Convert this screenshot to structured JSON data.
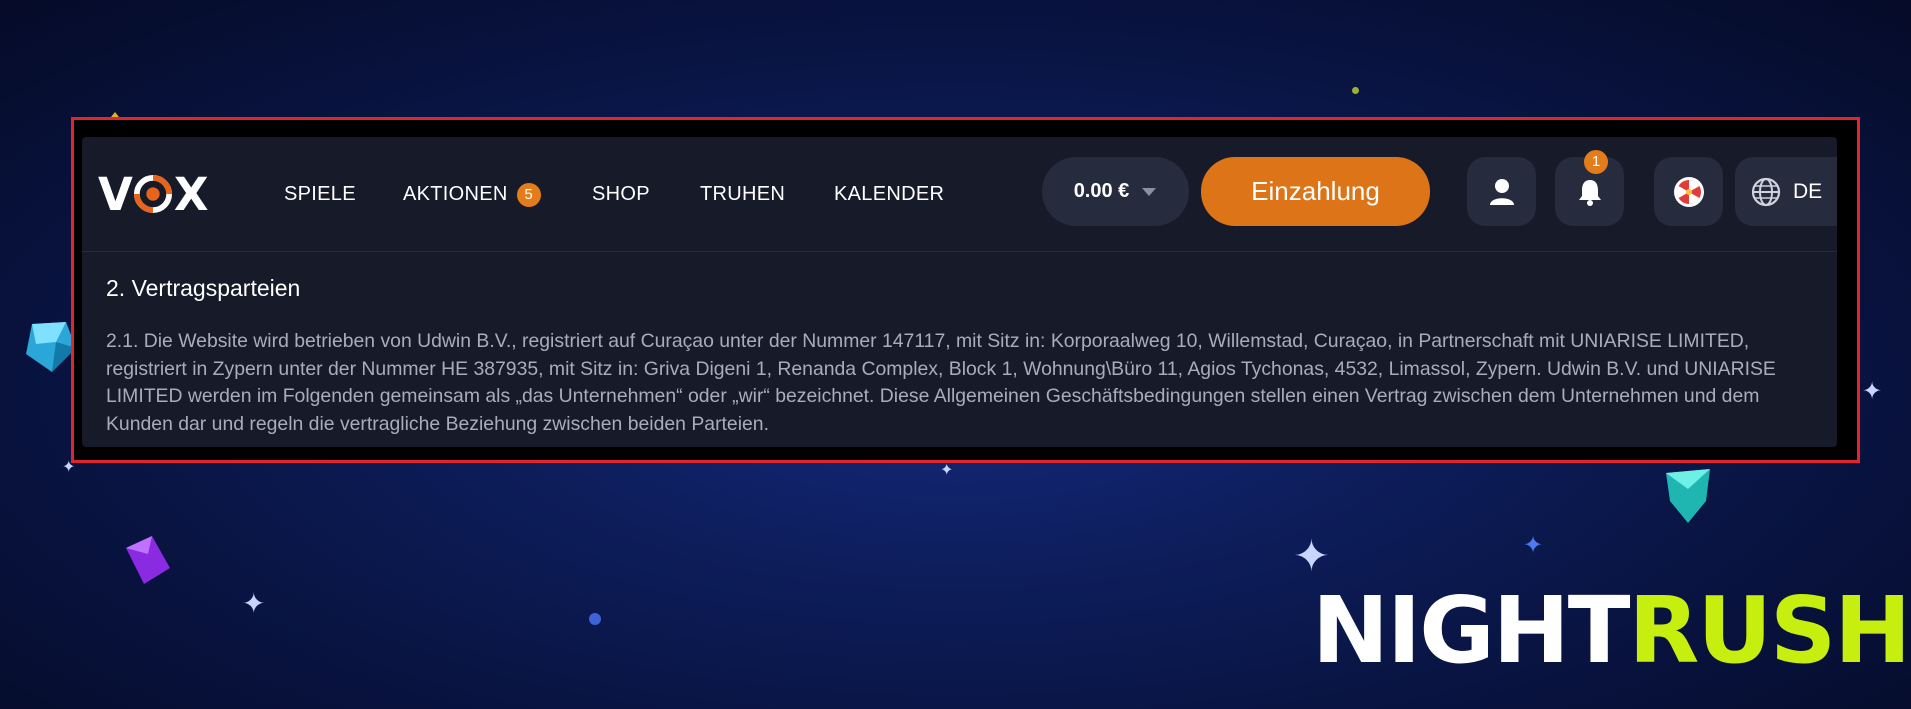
{
  "logo": {
    "text_left": "V",
    "text_right": "X"
  },
  "nav": [
    {
      "label": "SPIELE"
    },
    {
      "label": "AKTIONEN",
      "badge": "5"
    },
    {
      "label": "SHOP"
    },
    {
      "label": "TRUHEN"
    },
    {
      "label": "KALENDER"
    }
  ],
  "header": {
    "balance": "0.00 €",
    "deposit_label": "Einzahlung",
    "notification_count": "1",
    "language": "DE",
    "icons": [
      "user-icon",
      "bell-icon",
      "wheel-icon",
      "globe-icon",
      "chevron-down-icon"
    ]
  },
  "content": {
    "heading": "2. Vertragsparteien",
    "paragraph": "2.1. Die Website wird betrieben von Udwin B.V., registriert auf Curaçao unter der Nummer 147117, mit Sitz in: Korporaalweg 10, Willemstad, Curaçao, in Partnerschaft mit UNIARISE LIMITED, registriert in Zypern unter der Nummer HE 387935, mit Sitz in: Griva Digeni 1, Renanda Complex, Block 1, Wohnung\\Büro 11, Agios Tychonas, 4532, Limassol, Zypern. Udwin B.V. und UNIARISE LIMITED werden im Folgenden gemeinsam als „das Unternehmen“ oder „wir“ bezeichnet. Diese Allgemeinen Geschäftsbedingungen stellen einen Vertrag zwischen dem Unternehmen und dem Kunden dar und regeln die vertragliche Beziehung zwischen beiden Parteien."
  },
  "watermark": {
    "part1": "NIGHT",
    "part2": "RUSH"
  },
  "colors": {
    "accent_orange": "#dd7417",
    "highlight_red": "#e0252d",
    "brand_green": "#c6ef0f",
    "panel_bg": "#161a29"
  }
}
